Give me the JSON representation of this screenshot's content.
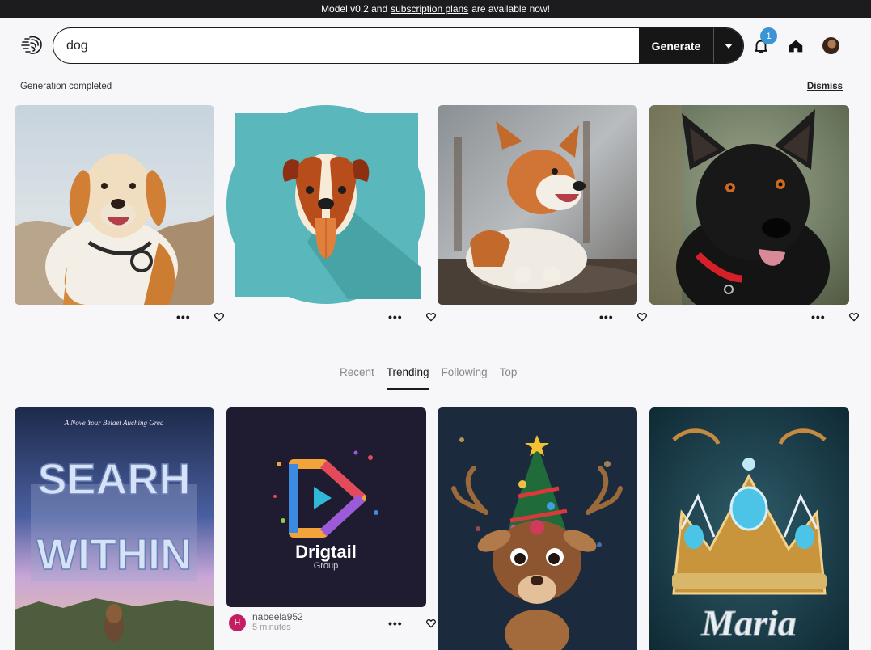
{
  "banner": {
    "prefix": "Model v0.2 and",
    "link": "subscription plans",
    "suffix": "are available now!"
  },
  "search": {
    "value": "dog",
    "generate_label": "Generate"
  },
  "notifications": {
    "count": "1"
  },
  "status": {
    "message": "Generation completed",
    "dismiss_label": "Dismiss"
  },
  "tabs": [
    {
      "label": "Recent",
      "active": false
    },
    {
      "label": "Trending",
      "active": true
    },
    {
      "label": "Following",
      "active": false
    },
    {
      "label": "Top",
      "active": false
    }
  ],
  "generated_images": [
    {
      "subject": "golden retriever in snow"
    },
    {
      "subject": "flat dog face illustration"
    },
    {
      "subject": "corgi on ground"
    },
    {
      "subject": "black dog with red collar"
    }
  ],
  "feed": [
    {
      "subject": "Search Within poster"
    },
    {
      "subject": "Drigtail Group logo",
      "logo_text": "Drigtail",
      "logo_sub": "Group",
      "author_initial": "H",
      "author": "nabeela952",
      "time": "5 minutes"
    },
    {
      "subject": "christmas reindeer"
    },
    {
      "subject": "crown with name",
      "crown_text": "Maria"
    }
  ],
  "poster": {
    "top_line": "A Nove Your Belaet Auching Grea",
    "word1": "SEARH",
    "word2": "WITHIN"
  },
  "colors": {
    "banner_bg": "#1c1c1e",
    "accent_badge": "#3b95d4",
    "author_avatar": "#c41e62"
  }
}
